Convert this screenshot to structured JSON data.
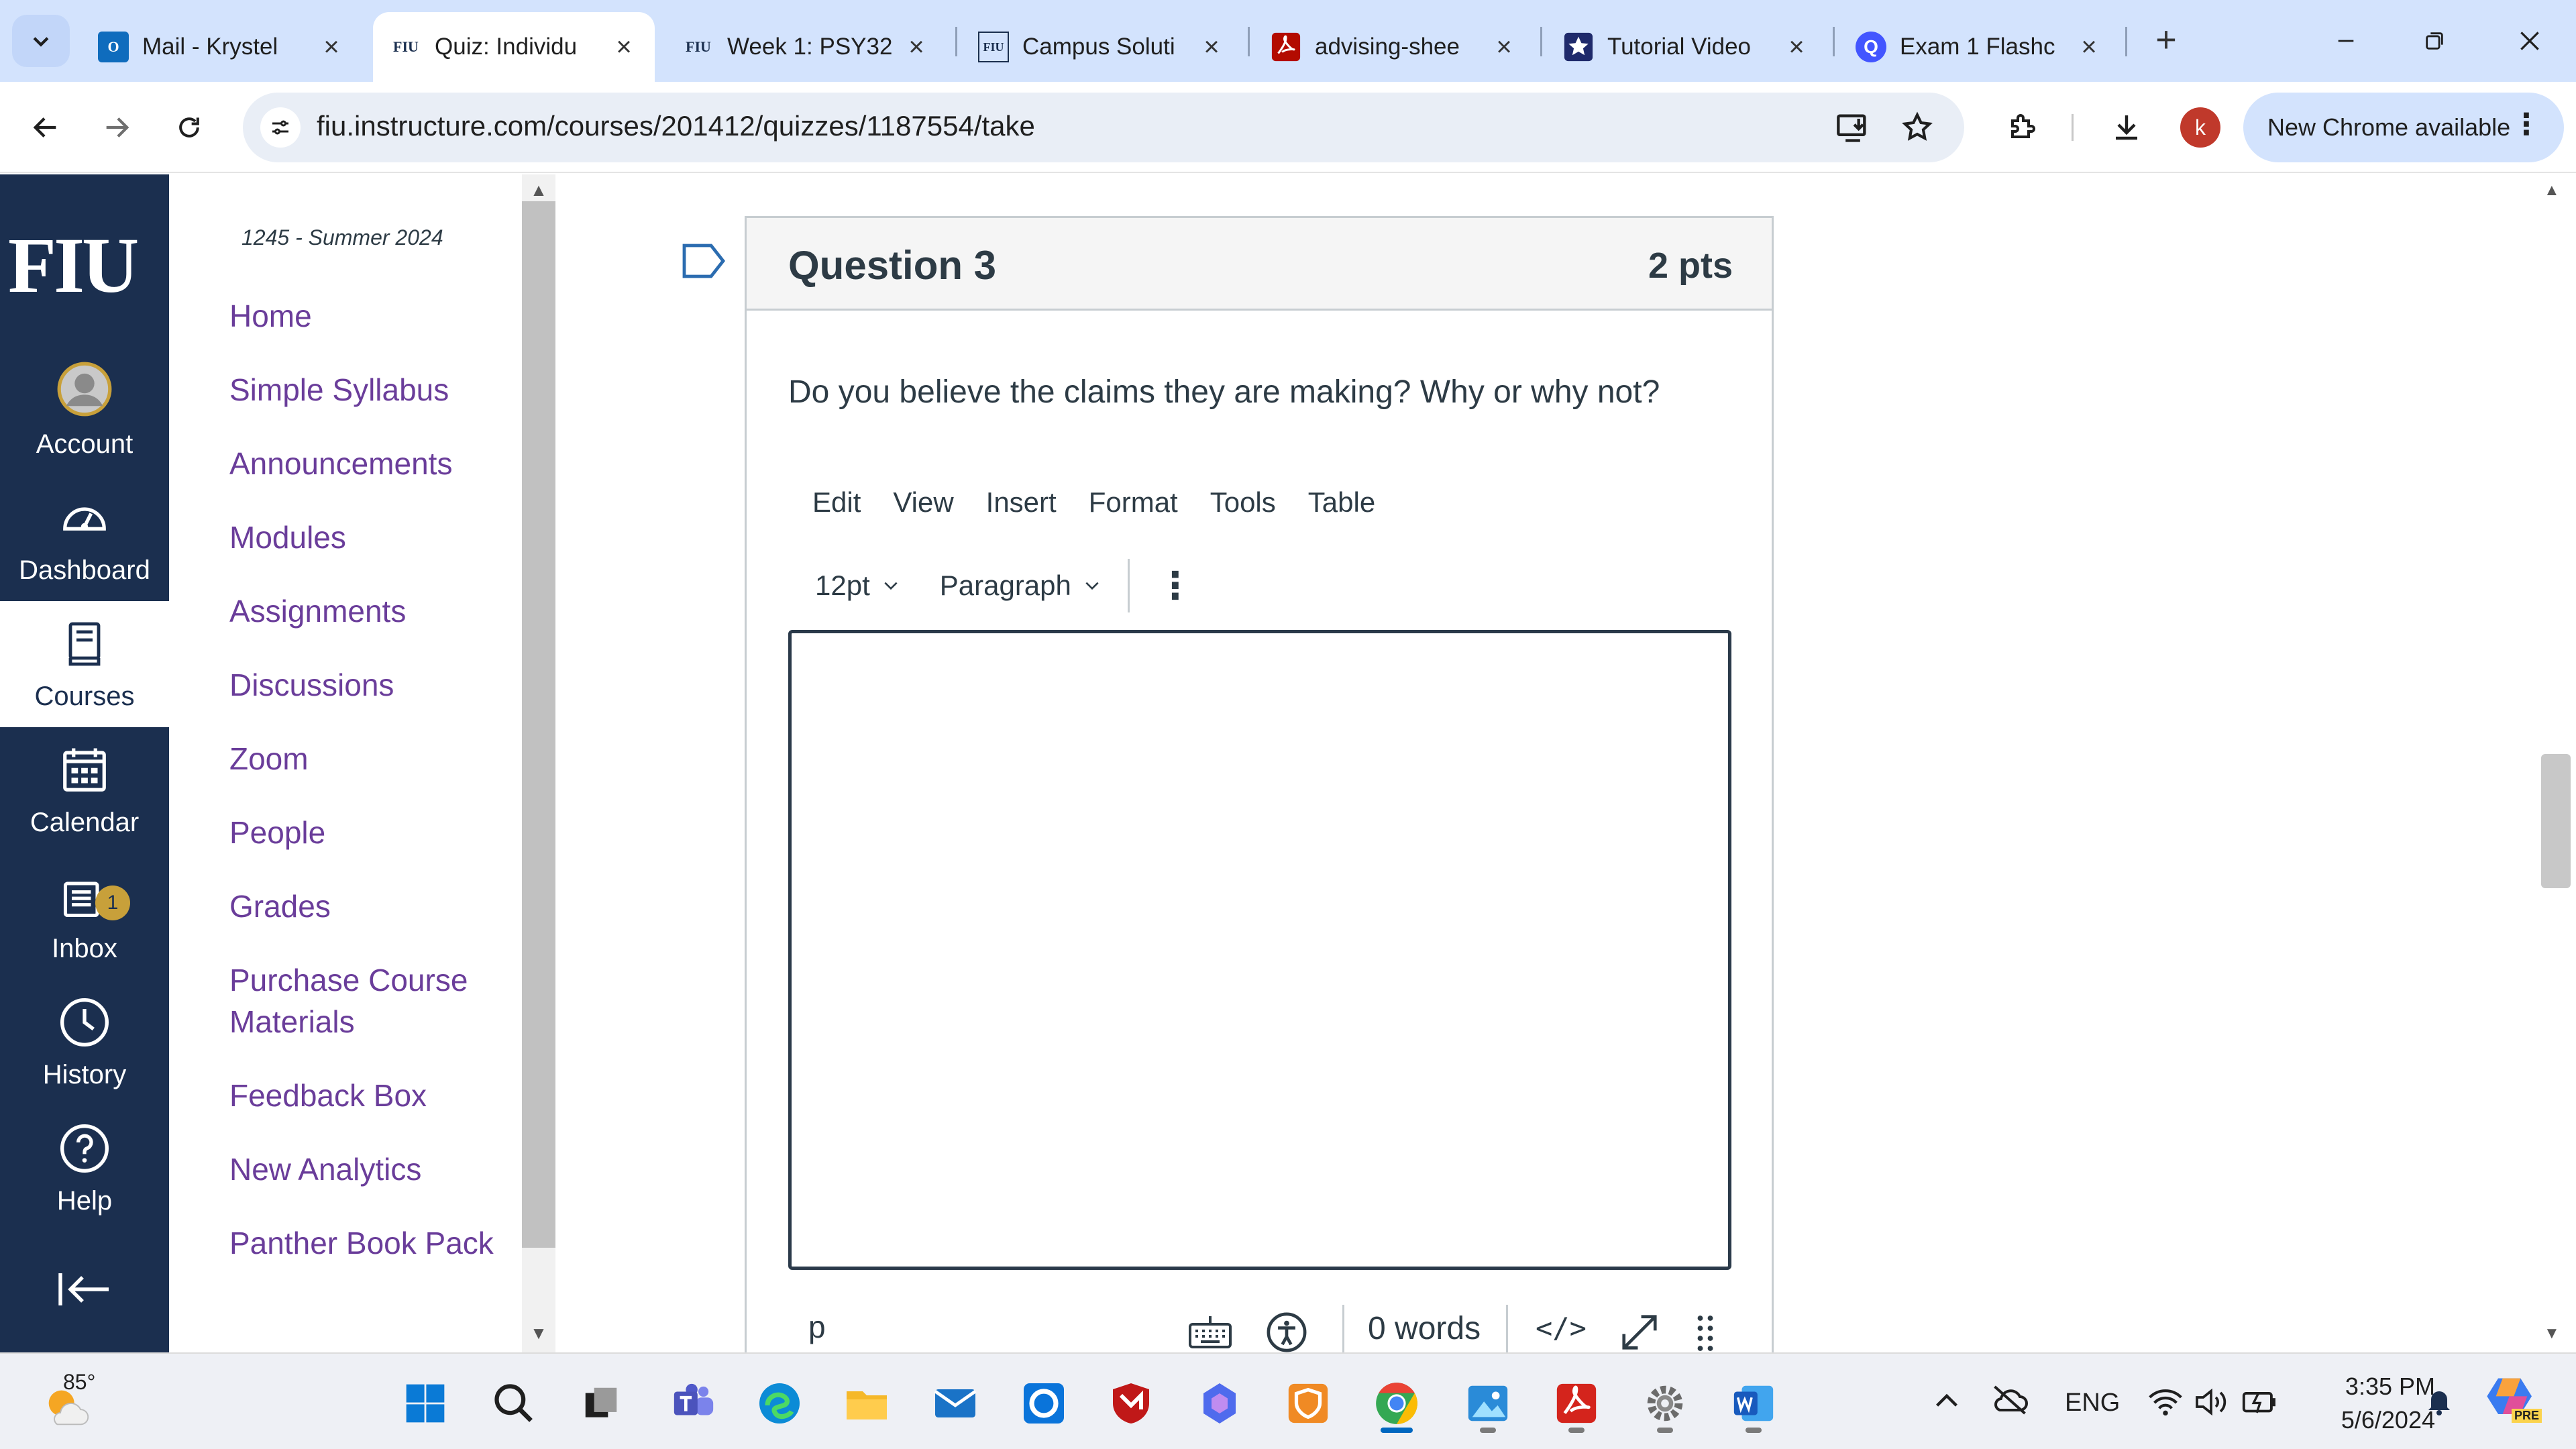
{
  "browser": {
    "tabs": [
      {
        "title": "Mail - Krystel",
        "favicon": "outlook-icon",
        "active": false
      },
      {
        "title": "Quiz: Individu",
        "favicon": "fiu-icon",
        "active": true
      },
      {
        "title": "Week 1: PSY32",
        "favicon": "fiu-icon",
        "active": false
      },
      {
        "title": "Campus Soluti",
        "favicon": "fiu-icon",
        "active": false
      },
      {
        "title": "advising-shee",
        "favicon": "pdf-icon",
        "active": false
      },
      {
        "title": "Tutorial Video",
        "favicon": "star-icon",
        "active": false
      },
      {
        "title": "Exam 1 Flashc",
        "favicon": "quizlet-icon",
        "active": false
      }
    ],
    "fav_text": {
      "fiu": "FIU",
      "outlook": "O",
      "quizlet": "Q"
    },
    "url": "fiu.instructure.com/courses/201412/quizzes/1187554/take",
    "profile_initial": "k",
    "update_label": "New Chrome available"
  },
  "global_nav": {
    "logo": "FIU",
    "items": [
      {
        "label": "Account",
        "icon": "account-avatar-icon"
      },
      {
        "label": "Dashboard",
        "icon": "dashboard-gauge-icon"
      },
      {
        "label": "Courses",
        "icon": "courses-book-icon",
        "selected": true
      },
      {
        "label": "Calendar",
        "icon": "calendar-icon"
      },
      {
        "label": "Inbox",
        "icon": "inbox-icon",
        "badge": "1"
      },
      {
        "label": "History",
        "icon": "history-clock-icon"
      },
      {
        "label": "Help",
        "icon": "help-icon"
      }
    ]
  },
  "course_nav": {
    "term": "1245 - Summer 2024",
    "links": [
      "Home",
      "Simple Syllabus",
      "Announcements",
      "Modules",
      "Assignments",
      "Discussions",
      "Zoom",
      "People",
      "Grades",
      "Purchase Course Materials",
      "Feedback Box",
      "New Analytics",
      "Panther Book Pack"
    ]
  },
  "question": {
    "title": "Question 3",
    "points": "2 pts",
    "text": "Do you believe the claims they are making? Why or why not?"
  },
  "editor": {
    "menu": [
      "Edit",
      "View",
      "Insert",
      "Format",
      "Tools",
      "Table"
    ],
    "font_size": "12pt",
    "block_format": "Paragraph",
    "element_path": "p",
    "word_count": "0 words",
    "code_toggle": "</>"
  },
  "taskbar": {
    "weather_temp": "85°",
    "language": "ENG",
    "time": "3:35 PM",
    "date": "5/6/2024",
    "copilot_badge": "PRE"
  },
  "colors": {
    "nav_bg": "#1b2f4f",
    "link": "#6a3d9a",
    "badge": "#c8a03a",
    "tabstrip": "#d3e3fd"
  }
}
